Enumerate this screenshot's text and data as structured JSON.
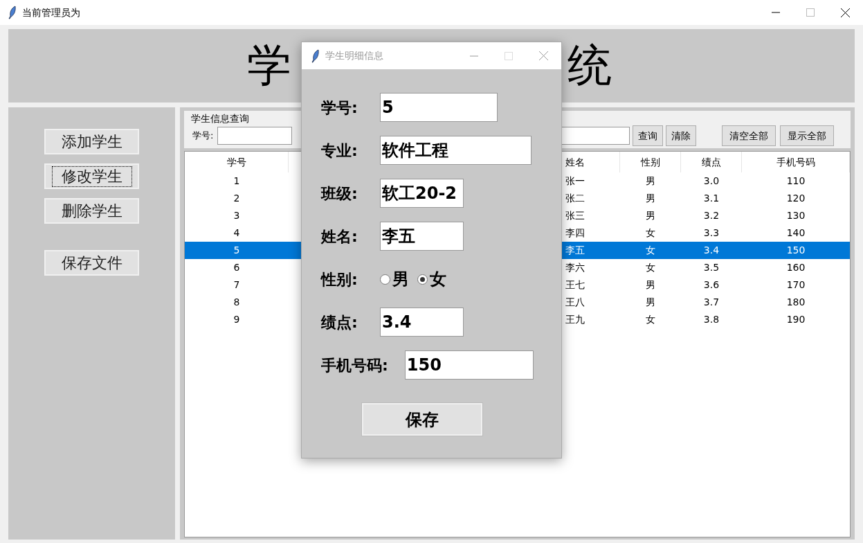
{
  "window": {
    "title": "当前管理员为"
  },
  "banner": {
    "title_left": "学",
    "title_right": "统"
  },
  "sidebar": {
    "buttons": [
      {
        "label": "添加学生",
        "focused": false
      },
      {
        "label": "修改学生",
        "focused": true
      },
      {
        "label": "删除学生",
        "focused": false
      },
      {
        "label": "保存文件",
        "focused": false
      }
    ]
  },
  "query": {
    "title": "学生信息查询",
    "id_label": "学号:",
    "buttons": [
      "查询",
      "清除"
    ],
    "right_buttons": [
      "清空全部",
      "显示全部"
    ]
  },
  "table": {
    "columns": [
      "学号",
      "姓名",
      "性别",
      "绩点",
      "手机号码"
    ],
    "rows": [
      {
        "id": "1",
        "name": "张一",
        "gender": "男",
        "gpa": "3.0",
        "phone": "110",
        "selected": false
      },
      {
        "id": "2",
        "name": "张二",
        "gender": "男",
        "gpa": "3.1",
        "phone": "120",
        "selected": false
      },
      {
        "id": "3",
        "name": "张三",
        "gender": "男",
        "gpa": "3.2",
        "phone": "130",
        "selected": false
      },
      {
        "id": "4",
        "name": "李四",
        "gender": "女",
        "gpa": "3.3",
        "phone": "140",
        "selected": false
      },
      {
        "id": "5",
        "name": "李五",
        "gender": "女",
        "gpa": "3.4",
        "phone": "150",
        "selected": true
      },
      {
        "id": "6",
        "name": "李六",
        "gender": "女",
        "gpa": "3.5",
        "phone": "160",
        "selected": false
      },
      {
        "id": "7",
        "name": "王七",
        "gender": "男",
        "gpa": "3.6",
        "phone": "170",
        "selected": false
      },
      {
        "id": "8",
        "name": "王八",
        "gender": "男",
        "gpa": "3.7",
        "phone": "180",
        "selected": false
      },
      {
        "id": "9",
        "name": "王九",
        "gender": "女",
        "gpa": "3.8",
        "phone": "190",
        "selected": false
      }
    ]
  },
  "dialog": {
    "title": "学生明细信息",
    "fields": [
      {
        "kind": "entry",
        "label": "学号:",
        "value": "5"
      },
      {
        "kind": "entry",
        "label": "专业:",
        "value": "软件工程"
      },
      {
        "kind": "entry",
        "label": "班级:",
        "value": "软工20-2"
      },
      {
        "kind": "entry",
        "label": "姓名:",
        "value": "李五"
      },
      {
        "kind": "radio",
        "label": "性别:",
        "options": [
          {
            "label": "男",
            "selected": false
          },
          {
            "label": "女",
            "selected": true
          }
        ]
      },
      {
        "kind": "entry",
        "label": "绩点:",
        "value": "3.4"
      },
      {
        "kind": "entry",
        "label": "手机号码:",
        "value": "150"
      }
    ],
    "save_button": "保存"
  }
}
